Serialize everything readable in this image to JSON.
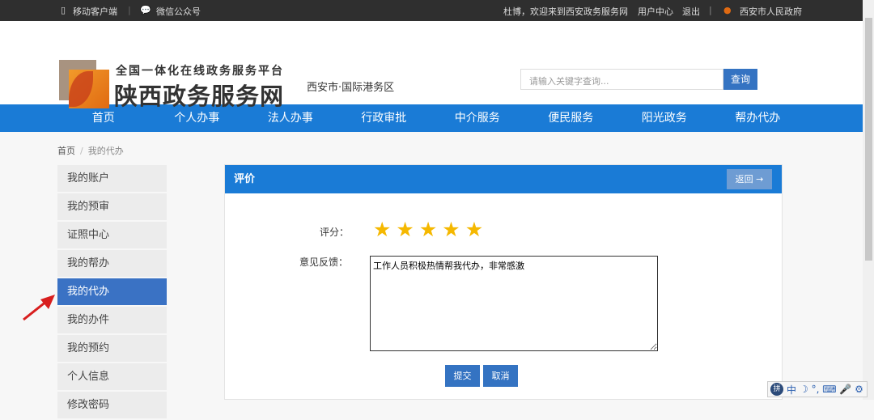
{
  "topbar": {
    "mobile": "移动客户端",
    "wechat": "微信公众号",
    "welcome": "杜博，欢迎来到西安政务服务网",
    "user_center": "用户中心",
    "logout": "退出",
    "gov": "西安市人民政府"
  },
  "header": {
    "slogan": "全国一体化在线政务服务平台",
    "site_name": "陕西政务服务网",
    "region": "西安市·国际港务区",
    "search_placeholder": "请输入关键字查询...",
    "search_button": "查询"
  },
  "nav": [
    "首页",
    "个人办事",
    "法人办事",
    "行政审批",
    "中介服务",
    "便民服务",
    "阳光政务",
    "帮办代办"
  ],
  "breadcrumb": {
    "home": "首页",
    "sep": "/",
    "current": "我的代办"
  },
  "sidebar": [
    "我的账户",
    "我的预审",
    "证照中心",
    "我的帮办",
    "我的代办",
    "我的办件",
    "我的预约",
    "个人信息",
    "修改密码"
  ],
  "panel": {
    "title": "评价",
    "back": "返回 →",
    "rating_label": "评分：",
    "rating": 5,
    "rating_max": 5,
    "feedback_label": "意见反馈：",
    "feedback": "工作人员积极热情帮我代办，非常感激",
    "submit": "提交",
    "cancel": "取消"
  },
  "ime": {
    "logo": "拼",
    "lang": "中",
    "icons": "☽ °, ⌨ 🎤 ⚙"
  },
  "colors": {
    "nav": "#1a7bd6",
    "active": "#3a72c4",
    "star": "#f5b800"
  }
}
